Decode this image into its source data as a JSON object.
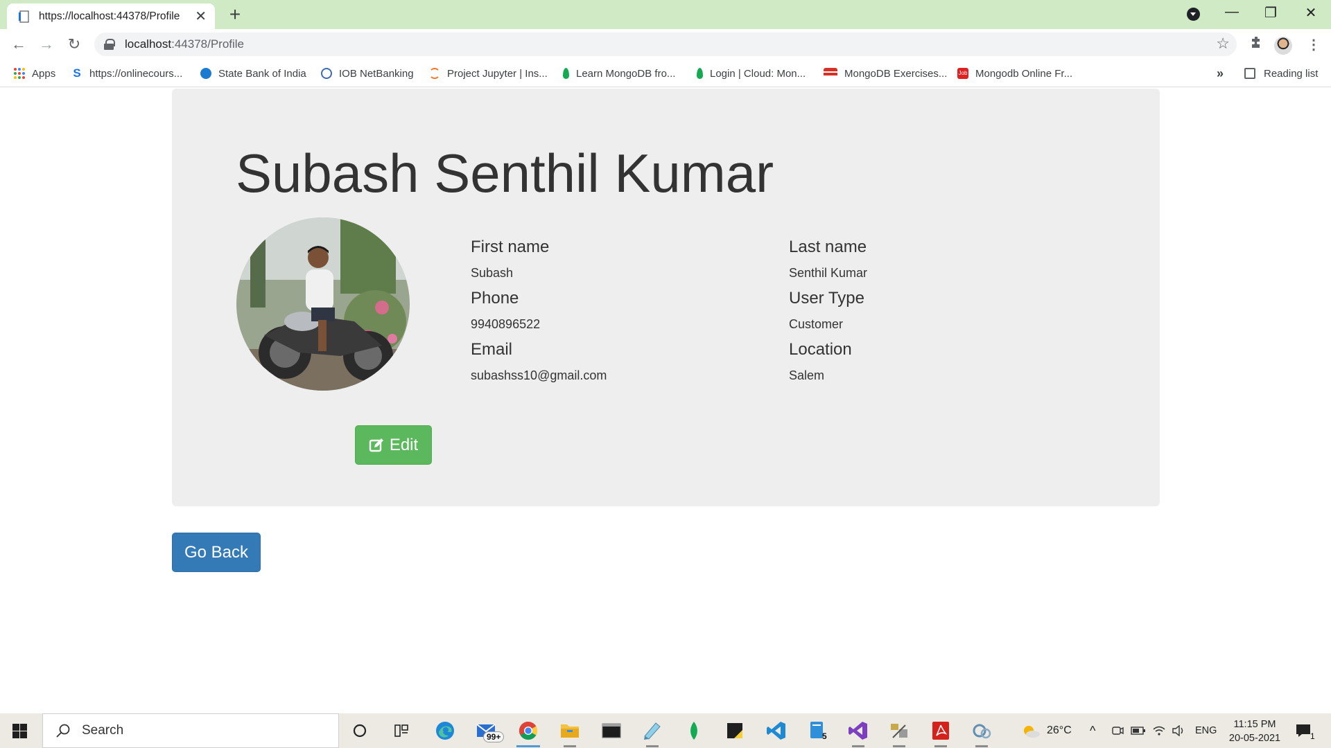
{
  "browser": {
    "tab_title": "https://localhost:44378/Profile",
    "url_host": "localhost",
    "url_rest": ":44378/Profile",
    "bookmarks": [
      {
        "label": "Apps"
      },
      {
        "label": "https://onlinecours..."
      },
      {
        "label": "State Bank of India"
      },
      {
        "label": "IOB NetBanking"
      },
      {
        "label": "Project Jupyter | Ins..."
      },
      {
        "label": "Learn MongoDB fro..."
      },
      {
        "label": "Login | Cloud: Mon..."
      },
      {
        "label": "MongoDB Exercises..."
      },
      {
        "label": "Mongodb Online Fr..."
      }
    ],
    "overflow_label": "»",
    "reading_list_label": "Reading list"
  },
  "profile": {
    "full_name": "Subash Senthil Kumar",
    "fields": {
      "first_name_label": "First name",
      "first_name_value": "Subash",
      "last_name_label": "Last name",
      "last_name_value": "Senthil Kumar",
      "phone_label": "Phone",
      "phone_value": "9940896522",
      "user_type_label": "User Type",
      "user_type_value": "Customer",
      "email_label": "Email",
      "email_value": "subashss10@gmail.com",
      "location_label": "Location",
      "location_value": "Salem"
    },
    "edit_button_label": "Edit",
    "back_button_label": "Go Back"
  },
  "taskbar": {
    "search_placeholder": "Search",
    "mail_badge": "99+",
    "files_badge": "5",
    "weather": "26°C",
    "language": "ENG",
    "time": "11:15 PM",
    "date": "20-05-2021",
    "notification_count": "1"
  },
  "colors": {
    "tab_strip": "#cfeac4",
    "jumbotron": "#eeeeee",
    "edit_button": "#5cb85c",
    "back_button": "#337ab7"
  }
}
